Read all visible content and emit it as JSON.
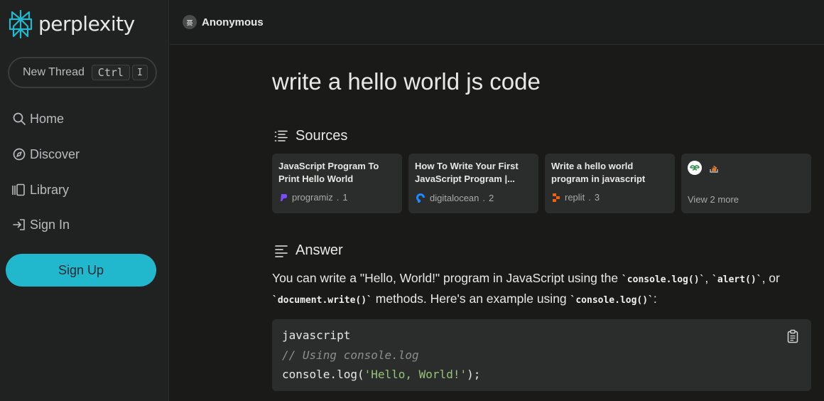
{
  "brand": {
    "name": "perplexity",
    "accent": "#21b8cd"
  },
  "sidebar": {
    "new_thread": {
      "label": "New Thread",
      "kbd_ctrl": "Ctrl",
      "kbd_key": "I"
    },
    "items": [
      {
        "label": "Home",
        "icon": "search-icon"
      },
      {
        "label": "Discover",
        "icon": "compass-icon"
      },
      {
        "label": "Library",
        "icon": "library-icon"
      },
      {
        "label": "Sign In",
        "icon": "sign-in-icon"
      }
    ],
    "signup_label": "Sign Up"
  },
  "header": {
    "user": "Anonymous",
    "avatar_icon": "anonymous-avatar-icon"
  },
  "main": {
    "query": "write a hello world js code",
    "sources": {
      "heading": "Sources",
      "cards": [
        {
          "title": "JavaScript Program To Print Hello World",
          "site": "programiz",
          "index": "1",
          "icon": "programiz-favicon"
        },
        {
          "title": "How To Write Your First JavaScript Program |...",
          "site": "digitalocean",
          "index": "2",
          "icon": "digitalocean-favicon"
        },
        {
          "title": "Write a hello world program in javascript",
          "site": "replit",
          "index": "3",
          "icon": "replit-favicon"
        }
      ],
      "more": {
        "label": "View 2 more",
        "icons": [
          "geeksforgeeks-favicon",
          "stackoverflow-favicon"
        ]
      }
    },
    "answer": {
      "heading": "Answer",
      "intro": "You can write a \"Hello, World!\" program in JavaScript using the ",
      "code1": "`console.log()`",
      "sep1": ", ",
      "code2": "`alert()`",
      "sep2": ", or ",
      "code3": "`document.write()`",
      "mid": " methods. Here's an example using ",
      "code4": "`console.log()`",
      "end": ":"
    },
    "code": {
      "language": "javascript",
      "comment": "// Using console.log",
      "fn": "console.log(",
      "string": "'Hello, World!'",
      "close": ");",
      "copy_icon": "clipboard-icon"
    }
  }
}
